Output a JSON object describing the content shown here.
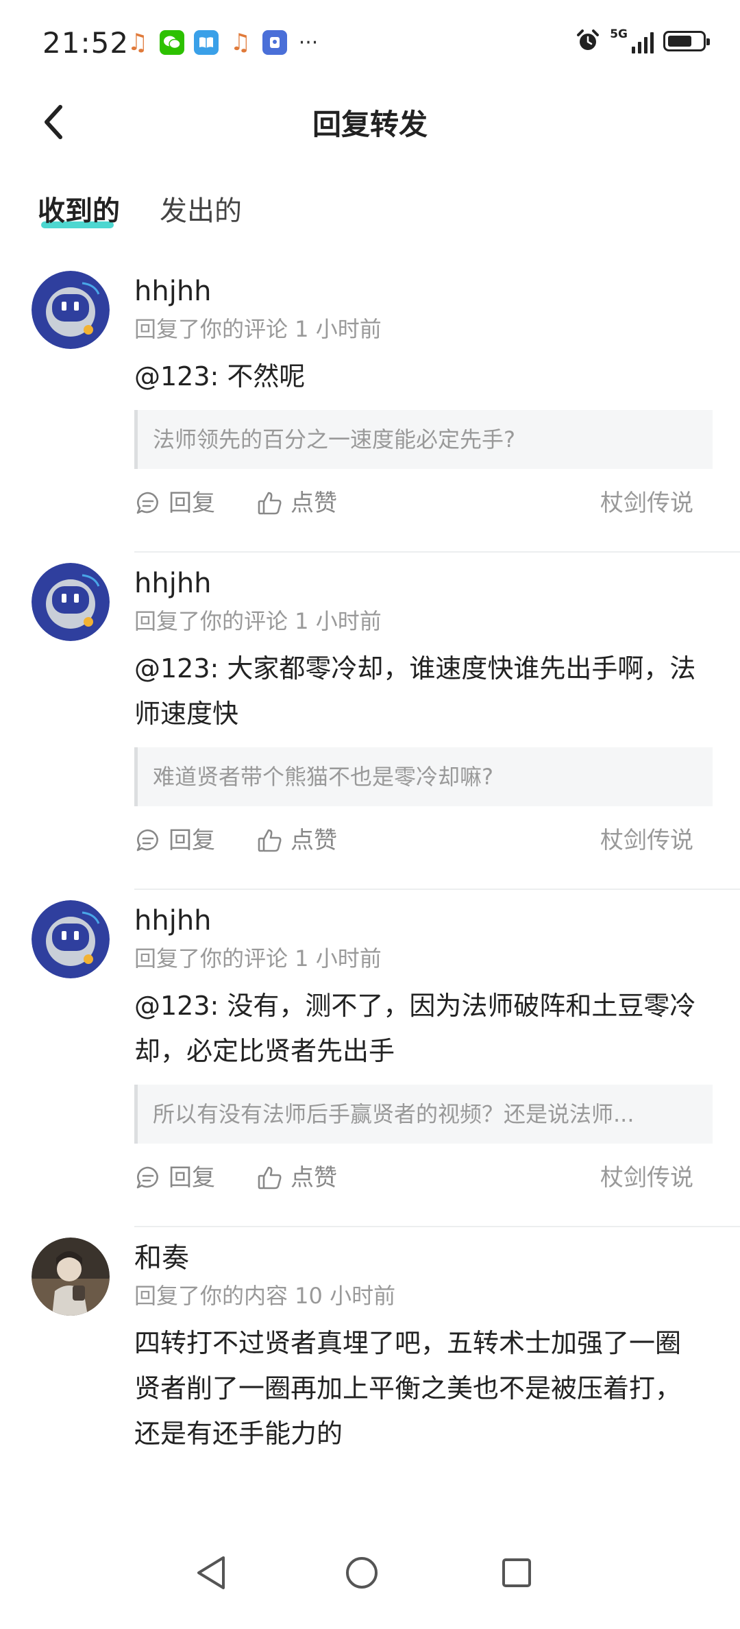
{
  "status_bar": {
    "time": "21:52",
    "notification_icons": [
      "music-icon",
      "wechat-icon",
      "book-icon",
      "music-icon",
      "app-icon",
      "more-dots-icon"
    ],
    "network_label": "5G",
    "battery_level": 0.7
  },
  "header": {
    "title": "回复转发",
    "back_icon": "chevron-left-icon"
  },
  "tabs": [
    {
      "label": "收到的",
      "active": true
    },
    {
      "label": "发出的",
      "active": false
    }
  ],
  "colors": {
    "accent": "#2ed0c8",
    "text_primary": "#222222",
    "text_secondary": "#999999"
  },
  "items": [
    {
      "name": "hhjhh",
      "meta": "回复了你的评论 1 小时前",
      "text": "@123: 不然呢",
      "quote": "法师领先的百分之一速度能必定先手?",
      "reply_label": "回复",
      "like_label": "点赞",
      "source": "杖剑传说"
    },
    {
      "name": "hhjhh",
      "meta": "回复了你的评论 1 小时前",
      "text": "@123: 大家都零冷却，谁速度快谁先出手啊，法师速度快",
      "quote": "难道贤者带个熊猫不也是零冷却嘛?",
      "reply_label": "回复",
      "like_label": "点赞",
      "source": "杖剑传说"
    },
    {
      "name": "hhjhh",
      "meta": "回复了你的评论 1 小时前",
      "text": "@123: 没有，测不了，因为法师破阵和土豆零冷却，必定比贤者先出手",
      "quote": "所以有没有法师后手赢贤者的视频？还是说法师...",
      "reply_label": "回复",
      "like_label": "点赞",
      "source": "杖剑传说"
    },
    {
      "name": "和奏",
      "meta": "回复了你的内容 10 小时前",
      "text": "四转打不过贤者真埋了吧，五转术士加强了一圈贤者削了一圈再加上平衡之美也不是被压着打，还是有还手能力的"
    }
  ],
  "navbar": {
    "buttons": [
      "back-triangle-icon",
      "home-circle-icon",
      "recents-square-icon"
    ]
  }
}
